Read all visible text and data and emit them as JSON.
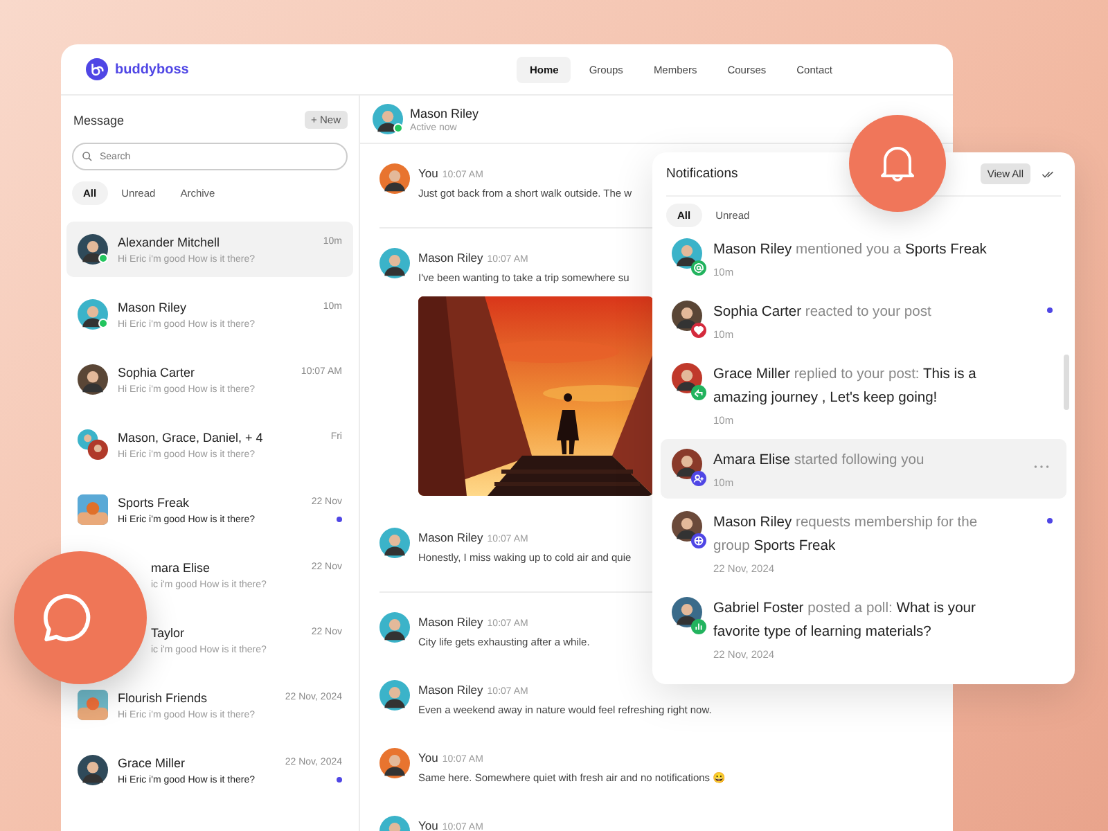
{
  "brand": {
    "name": "buddyboss"
  },
  "nav": [
    {
      "label": "Home",
      "selected": true
    },
    {
      "label": "Groups",
      "selected": false
    },
    {
      "label": "Members",
      "selected": false
    },
    {
      "label": "Courses",
      "selected": false
    },
    {
      "label": "Contact",
      "selected": false
    }
  ],
  "sidebar": {
    "title": "Message",
    "new_button": "+ New",
    "search": {
      "placeholder": "Search"
    },
    "tabs": [
      {
        "label": "All",
        "selected": true
      },
      {
        "label": "Unread",
        "selected": false
      },
      {
        "label": "Archive",
        "selected": false
      }
    ],
    "items": [
      {
        "kind": "person",
        "name": "Alexander Mitchell",
        "time": "10m",
        "preview": "Hi Eric i'm good How is it there?",
        "online": true,
        "unread": false,
        "selected": true,
        "covered": false
      },
      {
        "kind": "person",
        "name": "Mason Riley",
        "time": "10m",
        "preview": "Hi Eric i'm good How is it there?",
        "online": true,
        "unread": false,
        "selected": false,
        "covered": false
      },
      {
        "kind": "person",
        "name": "Sophia Carter",
        "time": "10:07 AM",
        "preview": "Hi Eric i'm good How is it there?",
        "online": false,
        "unread": false,
        "selected": false,
        "covered": false
      },
      {
        "kind": "multi",
        "name": "Mason, Grace, Daniel, + 4",
        "time": "Fri",
        "preview": "Hi Eric i'm good How is it there?",
        "online": false,
        "unread": false,
        "selected": false,
        "covered": false
      },
      {
        "kind": "group",
        "name": "Sports Freak",
        "time": "22 Nov",
        "preview": "Hi Eric i'm good How is it there?",
        "online": false,
        "unread": true,
        "selected": false,
        "covered": false
      },
      {
        "name": "mara Elise",
        "time": "22 Nov",
        "preview": "ic i'm good How is it there?",
        "online": false,
        "unread": false,
        "selected": false,
        "covered": true
      },
      {
        "name": "Taylor",
        "time": "22 Nov",
        "preview": "ic i'm good How is it there?",
        "online": false,
        "unread": false,
        "selected": false,
        "covered": true
      },
      {
        "kind": "group",
        "name": "Flourish Friends",
        "time": "22 Nov, 2024",
        "preview": "Hi Eric i'm good How is it there?",
        "online": false,
        "unread": false,
        "selected": false,
        "covered": false
      },
      {
        "kind": "person",
        "name": "Grace Miller",
        "time": "22 Nov, 2024",
        "preview": "Hi Eric i'm good How is it there?",
        "online": false,
        "unread": true,
        "selected": false,
        "covered": false
      }
    ]
  },
  "chat": {
    "name": "Mason Riley",
    "status": "Active now",
    "online": true,
    "messages": [
      {
        "sender": "You",
        "time": "10:07 AM",
        "text": "Just got back from a short walk outside. The w",
        "picture": false,
        "separated": true
      },
      {
        "sender": "Mason Riley",
        "time": "10:07 AM",
        "text": "I've been wanting to take a trip somewhere su",
        "picture": true,
        "separated": false
      },
      {
        "sender": "Mason Riley",
        "time": "10:07 AM",
        "text": "Honestly, I miss waking up to cold air and quie",
        "picture": false,
        "separated": true
      },
      {
        "sender": "Mason Riley",
        "time": "10:07 AM",
        "text": "City life gets exhausting after a while.",
        "picture": false,
        "separated": false
      },
      {
        "sender": "Mason Riley",
        "time": "10:07 AM",
        "text": "Even a weekend away in nature would feel refreshing right now.",
        "picture": false,
        "separated": false
      },
      {
        "sender": "You",
        "time": "10:07 AM",
        "text": "Same here. Somewhere quiet with fresh air and no notifications 😀",
        "picture": false,
        "separated": false
      },
      {
        "sender": "You",
        "time": "10:07 AM",
        "picture": false,
        "separated": false
      }
    ]
  },
  "notifications": {
    "title": "Notifications",
    "view_all": "View All",
    "tabs": [
      {
        "label": "All",
        "selected": true
      },
      {
        "label": "Unread",
        "selected": false
      }
    ],
    "items": [
      {
        "kind": "mention",
        "color": "#22b35e",
        "text": "**Mason Riley** mentioned you a **Sports Freak**",
        "time": "10m",
        "unread": false,
        "selected": false
      },
      {
        "kind": "reaction",
        "color": "#d42a3c",
        "text": "**Sophia Carter** reacted to your post",
        "time": "10m",
        "unread": true,
        "selected": false
      },
      {
        "kind": "reply",
        "color": "#22b35e",
        "text": "**Grace Miller** replied to your post: **This is a amazing journey , Let's keep going!**",
        "time": "10m",
        "unread": false,
        "selected": false
      },
      {
        "kind": "follow",
        "color": "#4f46e5",
        "text": "**Amara Elise** started following you",
        "time": "10m",
        "unread": false,
        "selected": true
      },
      {
        "kind": "request",
        "color": "#4f46e5",
        "text": "**Mason Riley** requests membership for the group **Sports Freak**",
        "time": "22 Nov, 2024",
        "unread": true,
        "selected": false
      },
      {
        "kind": "poll",
        "color": "#22b35e",
        "text": "**Gabriel Foster** posted a poll: **What is your favorite type of learning materials?**",
        "time": "22 Nov, 2024",
        "unread": false,
        "selected": false
      }
    ]
  }
}
